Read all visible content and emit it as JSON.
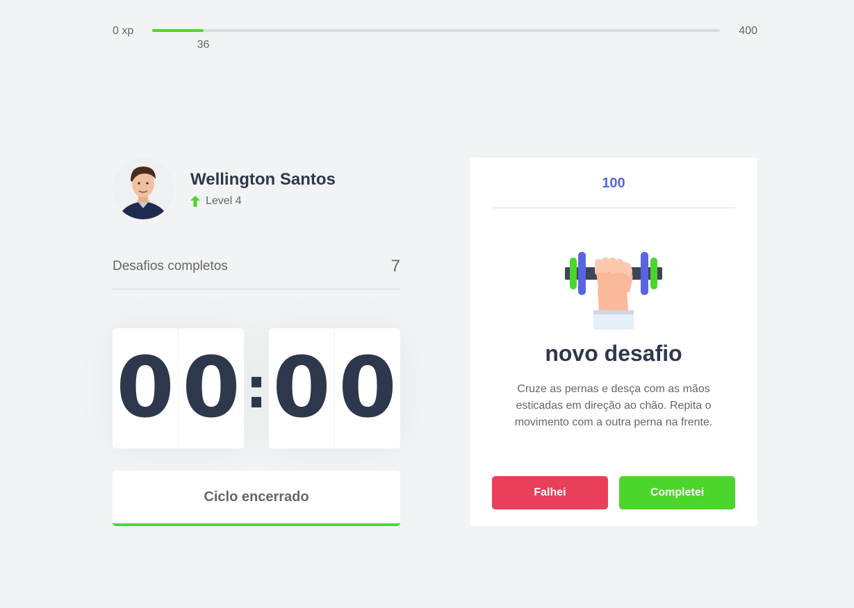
{
  "xp": {
    "min_label": "0 xp",
    "max_label": "400",
    "current": "36",
    "progress_fraction": 0.09,
    "fill_color": "#4cd62b"
  },
  "profile": {
    "name": "Wellington Santos",
    "level": "Level 4",
    "level_icon": "level-up-arrow-icon"
  },
  "completed": {
    "label": "Desafios completos",
    "count": "7"
  },
  "countdown": {
    "minute_left": "0",
    "minute_right": "0",
    "separator": ":",
    "second_left": "0",
    "second_right": "0"
  },
  "cycle": {
    "button_label": "Ciclo encerrado",
    "accent_color": "#4cd62b"
  },
  "challenge": {
    "xp_amount": "100",
    "illustration": "dumbbell-hand-icon",
    "title": "novo desafio",
    "description": "Cruze as pernas e desça com as mãos esticadas em direção ao chão. Repita o movimento com a outra perna na frente.",
    "fail_label": "Falhei",
    "success_label": "Completei",
    "fail_color": "#e83f5b",
    "success_color": "#4cd62b"
  }
}
